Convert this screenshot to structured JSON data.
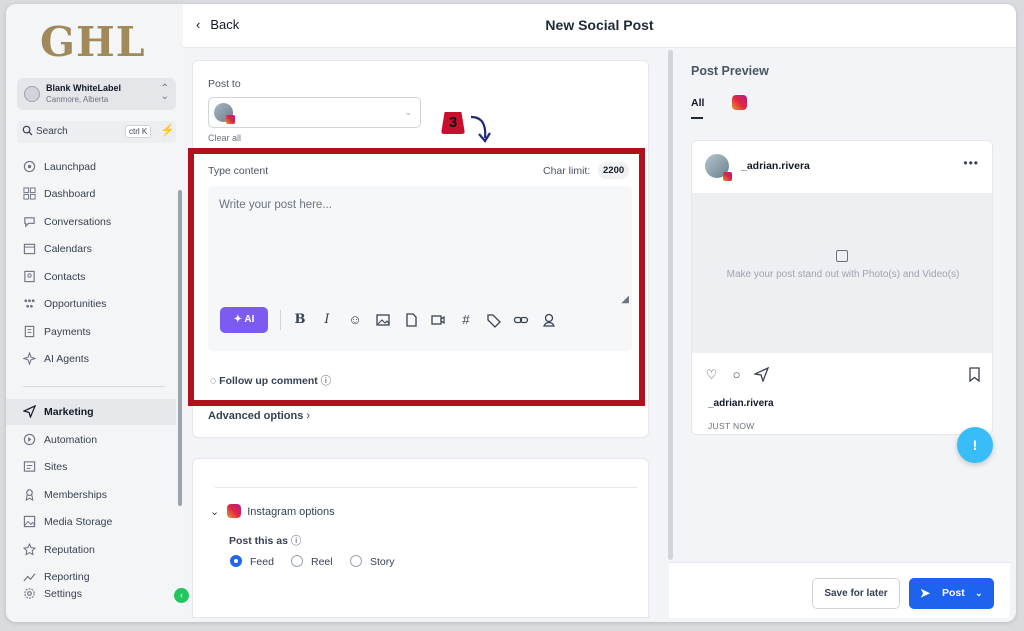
{
  "app": {
    "logo": "GHL"
  },
  "account": {
    "name": "Blank WhiteLabel",
    "location": "Canmore, Alberta"
  },
  "search": {
    "label": "Search",
    "shortcut": "ctrl K"
  },
  "sidebar": {
    "items": [
      {
        "label": "Launchpad",
        "icon": "rocket-icon"
      },
      {
        "label": "Dashboard",
        "icon": "grid-icon"
      },
      {
        "label": "Conversations",
        "icon": "chat-icon"
      },
      {
        "label": "Calendars",
        "icon": "calendar-icon"
      },
      {
        "label": "Contacts",
        "icon": "contact-icon"
      },
      {
        "label": "Opportunities",
        "icon": "funnel-icon"
      },
      {
        "label": "Payments",
        "icon": "receipt-icon"
      },
      {
        "label": "AI Agents",
        "icon": "sparkle-icon"
      },
      {
        "label": "Marketing",
        "icon": "send-icon",
        "active": true
      },
      {
        "label": "Automation",
        "icon": "automation-icon"
      },
      {
        "label": "Sites",
        "icon": "globe-icon"
      },
      {
        "label": "Memberships",
        "icon": "membership-icon"
      },
      {
        "label": "Media Storage",
        "icon": "image-icon"
      },
      {
        "label": "Reputation",
        "icon": "star-icon"
      },
      {
        "label": "Reporting",
        "icon": "chart-icon"
      },
      {
        "label": "Settings",
        "icon": "gear-icon"
      }
    ]
  },
  "header": {
    "back_label": "Back",
    "title": "New Social Post"
  },
  "composer": {
    "post_to_label": "Post to",
    "clear_all": "Clear all",
    "step_badge": "3",
    "type_content_label": "Type content",
    "char_limit_label": "Char limit:",
    "char_limit_value": "2200",
    "placeholder": "Write your post here...",
    "ai_label": "AI",
    "follow_up": "Follow up comment",
    "advanced": "Advanced options"
  },
  "instagram_options": {
    "title": "Instagram options",
    "post_as_label": "Post this as",
    "options": [
      "Feed",
      "Reel",
      "Story"
    ],
    "selected": "Feed"
  },
  "preview": {
    "title": "Post Preview",
    "tab_all": "All",
    "username": "_adrian.rivera",
    "media_hint": "Make your post stand out with Photo(s) and Video(s)",
    "timestamp": "JUST NOW"
  },
  "footer": {
    "save_later": "Save for later",
    "post": "Post"
  },
  "colors": {
    "accent": "#1d63ed",
    "ai": "#7c5cf0",
    "highlight": "#b3101d",
    "logo": "#a08a5c"
  }
}
